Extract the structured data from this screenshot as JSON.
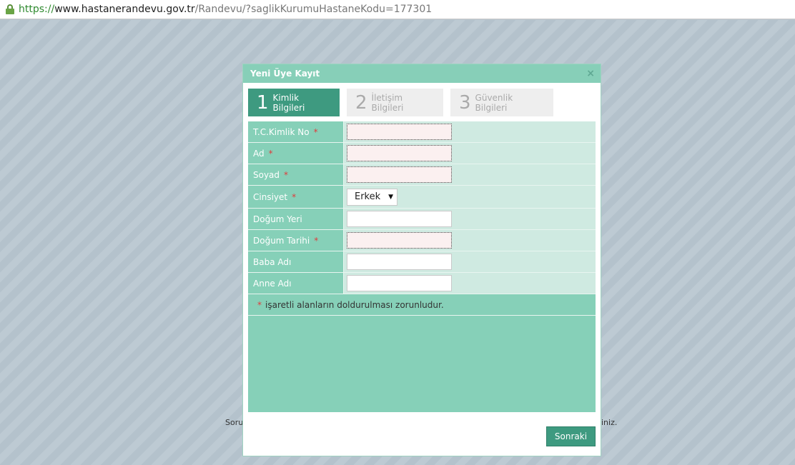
{
  "browser": {
    "url_scheme": "https://",
    "url_host": "www.hastanerandevu.gov.tr",
    "url_path": "/Randevu/?saglikKurumuHastaneKodu=177301"
  },
  "background": {
    "text_left": "Soru",
    "text_right": "iniz."
  },
  "modal": {
    "title": "Yeni Üye Kayıt",
    "close": "×",
    "steps": [
      {
        "number": "1",
        "label": "Kimlik Bilgileri"
      },
      {
        "number": "2",
        "label": "İletişim Bilgileri"
      },
      {
        "number": "3",
        "label": "Güvenlik Bilgileri"
      }
    ],
    "form": {
      "required_mark": "*",
      "fields": [
        {
          "label": "T.C.Kimlik No",
          "value": ""
        },
        {
          "label": "Ad",
          "value": ""
        },
        {
          "label": "Soyad",
          "value": ""
        },
        {
          "label": "Cinsiyet",
          "value": "Erkek"
        },
        {
          "label": "Doğum Yeri",
          "value": ""
        },
        {
          "label": "Doğum Tarihi",
          "value": ""
        },
        {
          "label": "Baba Adı",
          "value": ""
        },
        {
          "label": "Anne Adı",
          "value": ""
        }
      ]
    },
    "notice": "işaretli alanların doldurulması zorunludur.",
    "next_button": "Sonraki"
  }
}
